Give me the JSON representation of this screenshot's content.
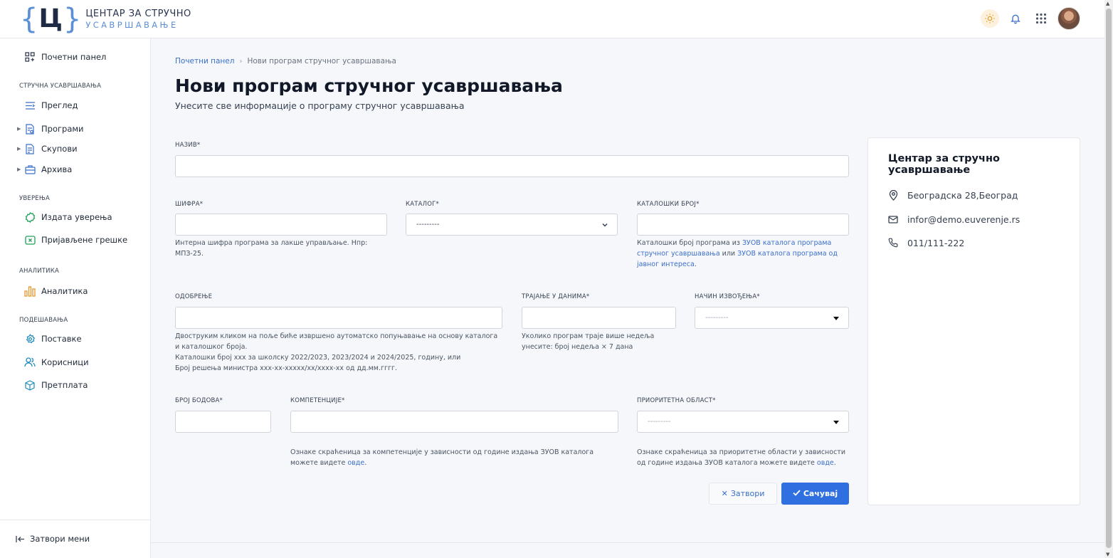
{
  "logo": {
    "line1": "ЦЕНТАР ЗА СТРУЧНО",
    "line2": "УСАВРШАВАЊЕ",
    "mark": "Ц"
  },
  "sidebar": {
    "home": "Почетни панел",
    "sections": [
      {
        "title": "СТРУЧНА УСАВРШАВАЊА",
        "items": [
          "Преглед",
          "Програми",
          "Скупови",
          "Архива"
        ]
      },
      {
        "title": "УВЕРЕЊА",
        "items": [
          "Издата уверења",
          "Пријављене грешке"
        ]
      },
      {
        "title": "АНАЛИТИКА",
        "items": [
          "Аналитика"
        ]
      },
      {
        "title": "ПОДЕШАВАЊА",
        "items": [
          "Поставке",
          "Корисници",
          "Претплата"
        ]
      }
    ],
    "close_menu": "Затвори мени"
  },
  "breadcrumb": {
    "home": "Почетни панел",
    "current": "Нови програм стручног усавршавања"
  },
  "page": {
    "title": "Нови програм стручног усавршавања",
    "subtitle": "Унесите све информације о програму стручног усавршавања"
  },
  "form": {
    "name_label": "НАЗИВ*",
    "code_label": "ШИФРА*",
    "code_help": "Интерна шифра програма за лакше управљање. Нпр: МПЗ-25.",
    "catalog_label": "КАТАЛОГ*",
    "catalog_value": "---------",
    "catno_label": "КАТАЛОШКИ БРОЈ*",
    "catno_help_1": "Каталошки број програма из ",
    "catno_link_1": "ЗУОВ каталога програма стручног усавршавања",
    "catno_help_2": " или ",
    "catno_link_2": "ЗУОВ каталога програма од јавног интереса",
    "catno_help_3": ".",
    "approval_label": "ОДОБРЕЊЕ",
    "approval_help_1": "Двоструким кликом на поље биће извршено аутоматско попуњавање на основу каталога и каталошког броја.",
    "approval_help_2": "Каталошки број xxx за школску 2022/2023, 2023/2024 и 2024/2025, годину, или",
    "approval_help_3": "Број решења министра xxx-xx-xxxxx/xx/xxxx-xx од дд.мм.гггг.",
    "duration_label": "ТРАЈАЊЕ У ДАНИМА*",
    "duration_help": "Уколико програм траје више недеља унесите: број недеља × 7 дана",
    "mode_label": "НАЧИН ИЗВОЂЕЊА*",
    "mode_value": "---------",
    "points_label": "БРОЈ БОДОВА*",
    "competences_label": "КОМПЕТЕНЦИЈЕ*",
    "competences_help": "Ознаке скраћеница за компетенције у зависности од године издања ЗУОВ каталога можете видете ",
    "competences_link": "овде",
    "priority_label": "ПРИОРИТЕТНА ОБЛАСТ*",
    "priority_value": "---------",
    "priority_help": "Ознаке скраћеница за приоритетне области у зависности од године издања ЗУОВ каталога можете видете ",
    "priority_link": "овде",
    "period": ".",
    "close_button": "Затвори",
    "save_button": "Сачувај"
  },
  "card": {
    "title": "Центар за стручно усавршавање",
    "address": "Београдска 28,Београд",
    "email": "infor@demo.euverenje.rs",
    "phone": "011/111-222"
  },
  "colors": {
    "accent": "#2f6fe0",
    "link": "#3b6fc9",
    "logo_blue": "#5b8fd6"
  }
}
